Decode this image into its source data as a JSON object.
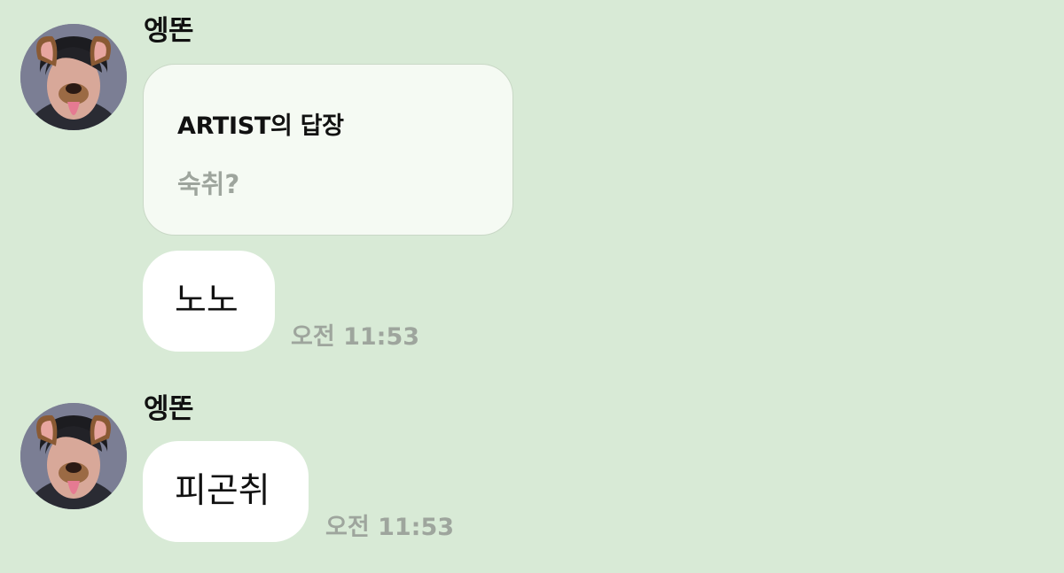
{
  "messages": [
    {
      "sender": "엥똔",
      "avatar_icon": "profile-dog-filter-icon",
      "reply": {
        "title": "ARTIST의 답장",
        "quoted": "숙취?"
      },
      "text": "노노",
      "time": "오전 11:53"
    },
    {
      "sender": "엥똔",
      "avatar_icon": "profile-dog-filter-icon",
      "text": "피곤취",
      "time": "오전 11:53"
    }
  ],
  "colors": {
    "background": "#d8ead6",
    "bubble": "#ffffff",
    "reply_bubble": "#f5faf3",
    "muted_text": "#9ea59d"
  }
}
